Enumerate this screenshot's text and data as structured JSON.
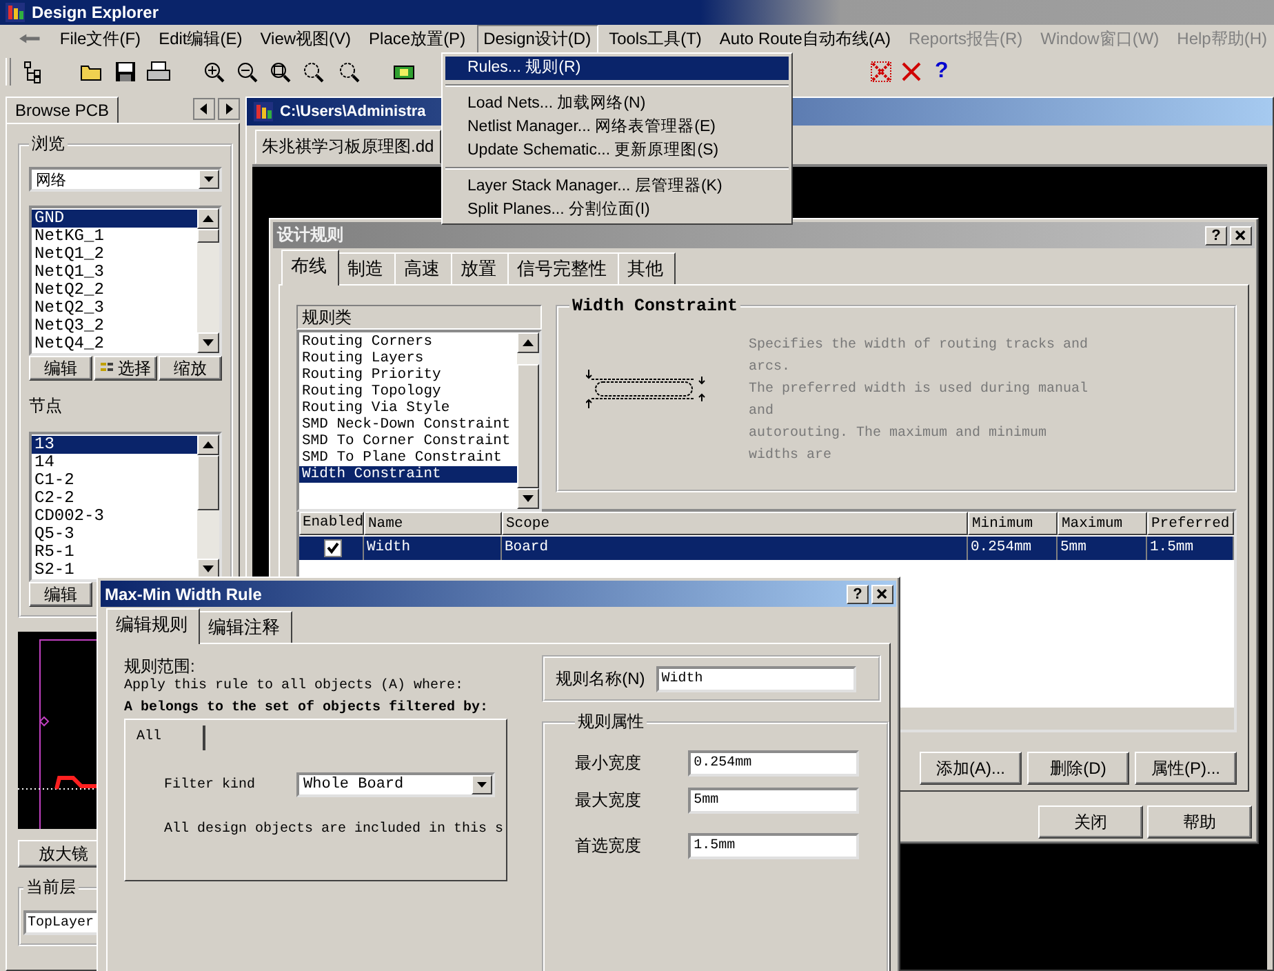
{
  "app_title": "Design Explorer",
  "menu": [
    {
      "label": "File文件(F)",
      "disabled": false,
      "open": false
    },
    {
      "label": "Edit编辑(E)",
      "disabled": false,
      "open": false
    },
    {
      "label": "View视图(V)",
      "disabled": false,
      "open": false
    },
    {
      "label": "Place放置(P)",
      "disabled": false,
      "open": false
    },
    {
      "label": "Design设计(D)",
      "disabled": false,
      "open": true
    },
    {
      "label": "Tools工具(T)",
      "disabled": false,
      "open": false
    },
    {
      "label": "Auto Route自动布线(A)",
      "disabled": false,
      "open": false
    },
    {
      "label": "Reports报告(R)",
      "disabled": true,
      "open": false
    },
    {
      "label": "Window窗口(W)",
      "disabled": true,
      "open": false
    },
    {
      "label": "Help帮助(H)",
      "disabled": true,
      "open": false
    }
  ],
  "design_menu": {
    "sections": [
      {
        "items": [
          {
            "label": "Rules... 规则(R)",
            "selected": true
          }
        ]
      },
      {
        "items": [
          {
            "label": "Load Nets... 加载网络(N)",
            "selected": false
          },
          {
            "label": "Netlist Manager... 网络表管理器(E)",
            "selected": false
          },
          {
            "label": "Update Schematic... 更新原理图(S)",
            "selected": false
          }
        ]
      },
      {
        "items": [
          {
            "label": "Layer Stack Manager... 层管理器(K)",
            "selected": false
          },
          {
            "label": "Split Planes... 分割位面(I)",
            "selected": false
          }
        ]
      }
    ]
  },
  "toolbar": {
    "help_glyph": "?"
  },
  "browse_panel": {
    "tab": "Browse PCB",
    "browse_group": "浏览",
    "browse_select": "网络",
    "nets": [
      {
        "label": "GND",
        "selected": true
      },
      {
        "label": "NetKG_1",
        "selected": false
      },
      {
        "label": "NetQ1_2",
        "selected": false
      },
      {
        "label": "NetQ1_3",
        "selected": false
      },
      {
        "label": "NetQ2_2",
        "selected": false
      },
      {
        "label": "NetQ2_3",
        "selected": false
      },
      {
        "label": "NetQ3_2",
        "selected": false
      },
      {
        "label": "NetQ4_2",
        "selected": false
      }
    ],
    "net_buttons": [
      "编辑",
      "选择",
      "缩放"
    ],
    "nodes_label": "节点",
    "nodes": [
      {
        "label": "13",
        "selected": true
      },
      {
        "label": "14",
        "selected": false
      },
      {
        "label": "C1-2",
        "selected": false
      },
      {
        "label": "C2-2",
        "selected": false
      },
      {
        "label": "CD002-3",
        "selected": false
      },
      {
        "label": "Q5-3",
        "selected": false
      },
      {
        "label": "R5-1",
        "selected": false
      },
      {
        "label": "S2-1",
        "selected": false
      }
    ],
    "node_buttons": [
      "编辑"
    ],
    "magnifier_button": "放大镜",
    "layer_group": "当前层",
    "layer_select": "TopLayer"
  },
  "document": {
    "title": "C:\\Users\\Administra",
    "tab": "朱兆祺学习板原理图.dd"
  },
  "rules_dialog": {
    "title": "设计规则",
    "help_glyph": "?",
    "tabs": [
      {
        "label": "布线",
        "selected": true
      },
      {
        "label": "制造",
        "selected": false
      },
      {
        "label": "高速",
        "selected": false
      },
      {
        "label": "放置",
        "selected": false
      },
      {
        "label": "信号完整性",
        "selected": false
      },
      {
        "label": "其他",
        "selected": false
      }
    ],
    "rule_class_header": "规则类",
    "rule_classes": [
      {
        "label": "Routing Corners",
        "selected": false
      },
      {
        "label": "Routing Layers",
        "selected": false
      },
      {
        "label": "Routing Priority",
        "selected": false
      },
      {
        "label": "Routing Topology",
        "selected": false
      },
      {
        "label": "Routing Via Style",
        "selected": false
      },
      {
        "label": "SMD Neck-Down Constraint",
        "selected": false
      },
      {
        "label": "SMD To Corner Constraint",
        "selected": false
      },
      {
        "label": "SMD To Plane Constraint",
        "selected": false
      },
      {
        "label": "Width Constraint",
        "selected": true
      }
    ],
    "constraint_title": "Width Constraint",
    "description_lines": [
      "Specifies the width of routing tracks and",
      "arcs.",
      "The preferred width is used during manual",
      "and",
      "autorouting. The maximum and minimum",
      "widths are"
    ],
    "columns": [
      "Enabled",
      "Name",
      "Scope",
      "Minimum",
      "Maximum",
      "Preferred"
    ],
    "rows": [
      {
        "enabled": true,
        "selected": true,
        "name": "Width",
        "scope": "Board",
        "minimum": "0.254mm",
        "maximum": "5mm",
        "preferred": "1.5mm"
      }
    ],
    "action_buttons": [
      "添加(A)...",
      "删除(D)",
      "属性(P)..."
    ],
    "footer_buttons": [
      "关闭",
      "帮助"
    ]
  },
  "rule_dialog": {
    "title": "Max-Min Width Rule",
    "help_glyph": "?",
    "tabs": [
      {
        "label": "编辑规则",
        "selected": true
      },
      {
        "label": "编辑注释",
        "selected": false
      }
    ],
    "scope_label": "规则范围:",
    "apply_text": "Apply this rule to all objects (A) where:",
    "filter_heading": "A belongs to the set of objects filtered by:",
    "filter_tab": "All",
    "filter_kind_label": "Filter kind",
    "filter_kind_value": "Whole Board",
    "filter_note": "All design objects are included in this s",
    "name_label": "规则名称(N)",
    "name_value": "Width",
    "props_group": "规则属性",
    "props": [
      {
        "label": "最小宽度",
        "value": "0.254mm"
      },
      {
        "label": "最大宽度",
        "value": "5mm"
      },
      {
        "label": "首选宽度",
        "value": "1.5mm"
      }
    ]
  }
}
